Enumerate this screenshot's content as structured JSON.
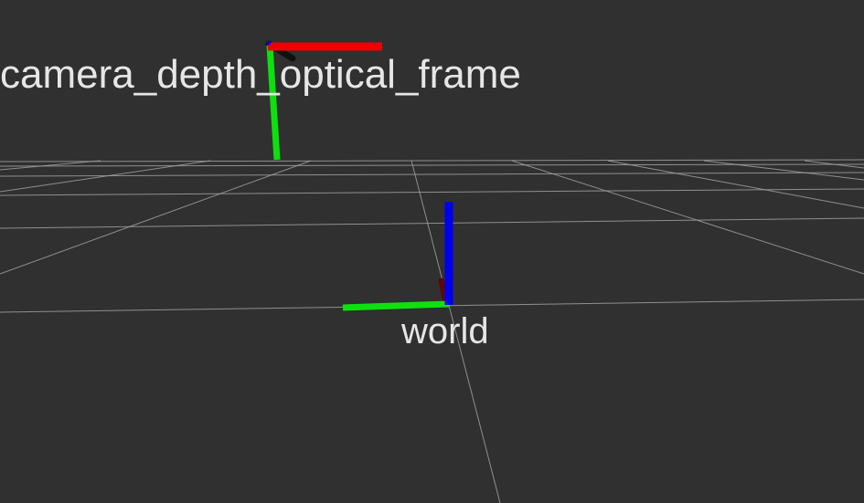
{
  "viewport": {
    "background": "#303030",
    "grid_color": "#a0a0a0"
  },
  "frames": [
    {
      "id": "camera",
      "name": "camera_depth_optical_frame",
      "axis_colors": {
        "x": "#ff0000",
        "y": "#00ff00",
        "z": "#0000ff"
      }
    },
    {
      "id": "world",
      "name": "world",
      "axis_colors": {
        "x": "#ff0000",
        "y": "#00ff00",
        "z": "#0000ff"
      }
    }
  ]
}
